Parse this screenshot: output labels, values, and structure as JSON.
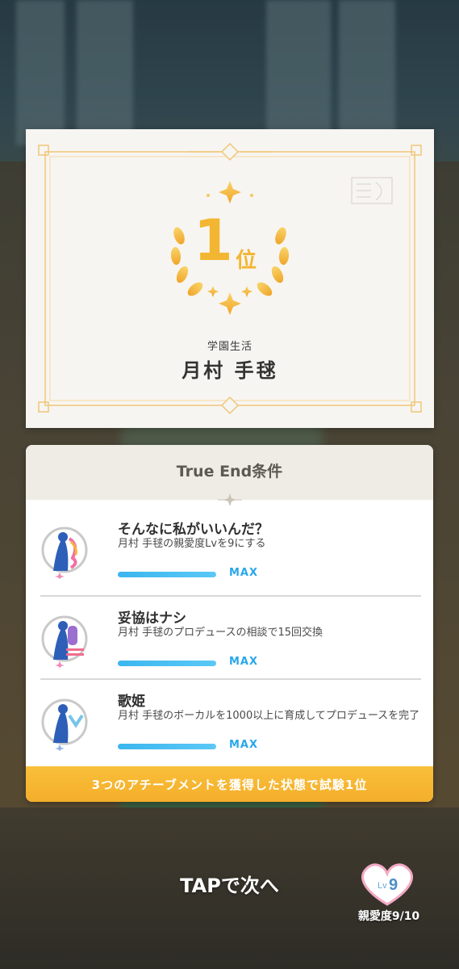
{
  "certificate": {
    "rank_number": "1",
    "rank_suffix": "位",
    "category": "学園生活",
    "name": "月村 手毬"
  },
  "conditions": {
    "title": "True End条件",
    "items": [
      {
        "title": "そんなに私がいいんだ？",
        "desc": "月村 手毬の親愛度Lvを9にする",
        "status": "MAX",
        "progress": 1.0
      },
      {
        "title": "妥協はナシ",
        "desc": "月村 手毬のプロデュースの相談で15回交換",
        "status": "MAX",
        "progress": 1.0
      },
      {
        "title": "歌姫",
        "desc": "月村 手毬のボーカルを1000以上に育成してプロデュースを完了",
        "status": "MAX",
        "progress": 1.0
      }
    ],
    "footer": "3つのアチーブメントを獲得した状態で試験1位"
  },
  "tap_prompt": "TAPで次へ",
  "affection": {
    "lv_prefix": "Lv",
    "level": "9",
    "label": "親愛度9/10"
  },
  "colors": {
    "gold": "#f3b632",
    "accent_blue": "#2aa7ea",
    "footer_orange": "#f6b22f"
  }
}
